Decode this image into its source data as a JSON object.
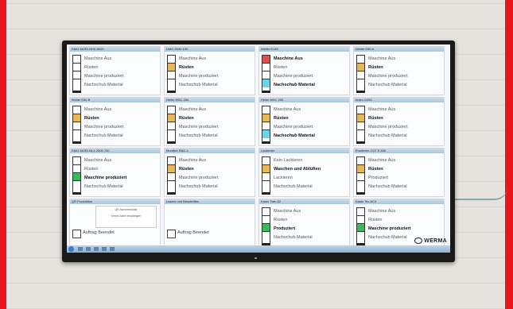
{
  "monitor": {
    "logo": "WERMA",
    "panels": [
      {
        "title": "DMG MORI NHX 8000",
        "labels": [
          "Maschine Aus",
          "Rüsten",
          "Maschine produziert",
          "Nachschub Material"
        ],
        "active": -1,
        "colors": [
          "#ffffff",
          "#ffffff",
          "#ffffff",
          "#ffffff"
        ]
      },
      {
        "title": "DMG DMU 100",
        "labels": [
          "Maschine Aus",
          "Rüsten",
          "Maschine produziert",
          "Nachschub Material"
        ],
        "active": 1,
        "colors": [
          "#ffffff",
          "#e8b857",
          "#ffffff",
          "#ffffff"
        ]
      },
      {
        "title": "Weiler E130",
        "labels": [
          "Maschine Aus",
          "Rüsten",
          "Maschine produziert",
          "Nachschub Material"
        ],
        "active": 0,
        "colors": [
          "#d9534f",
          "#ffffff",
          "#ffffff",
          "#6fd3e8"
        ],
        "bold": [
          0,
          3
        ]
      },
      {
        "title": "Weiler E50 A",
        "labels": [
          "Maschine Aus",
          "Rüsten",
          "Maschine produziert",
          "Nachschub Material"
        ],
        "active": 1,
        "colors": [
          "#ffffff",
          "#e8b857",
          "#ffffff",
          "#ffffff"
        ]
      },
      {
        "title": "Weiler E50 B",
        "labels": [
          "Maschine Aus",
          "Rüsten",
          "Maschine produziert",
          "Nachschub Material"
        ],
        "active": 1,
        "colors": [
          "#ffffff",
          "#e8b857",
          "#ffffff",
          "#ffffff"
        ]
      },
      {
        "title": "Heller MSC 250",
        "labels": [
          "Maschine Aus",
          "Rüsten",
          "Maschine produziert",
          "Nachschub Material"
        ],
        "active": 1,
        "colors": [
          "#ffffff",
          "#e8b857",
          "#ffffff",
          "#ffffff"
        ]
      },
      {
        "title": "Heller MSC 200",
        "labels": [
          "Maschine Aus",
          "Rüsten",
          "Maschine produziert",
          "Nachschub Material"
        ],
        "active": 1,
        "colors": [
          "#ffffff",
          "#e8b857",
          "#ffffff",
          "#6fd3e8"
        ],
        "bold": [
          1,
          3
        ]
      },
      {
        "title": "Index G250",
        "labels": [
          "Maschine Aus",
          "Rüsten",
          "Maschine produziert",
          "Nachschub Material"
        ],
        "active": 1,
        "colors": [
          "#ffffff",
          "#e8b857",
          "#ffffff",
          "#ffffff"
        ]
      },
      {
        "title": "DMG MORI NLX 2500 700",
        "labels": [
          "Maschine Aus",
          "Rüsten",
          "Maschine produziert",
          "Nachschub Material"
        ],
        "active": 2,
        "colors": [
          "#ffffff",
          "#ffffff",
          "#3cb95a",
          "#ffffff"
        ]
      },
      {
        "title": "Montfort RNC-1",
        "labels": [
          "Maschine Aus",
          "Rüsten",
          "Maschine produziert",
          "Nachschub Material"
        ],
        "active": 1,
        "colors": [
          "#ffffff",
          "#e8b857",
          "#ffffff",
          "#ffffff"
        ]
      },
      {
        "title": "Lackieren",
        "labels": [
          "Kein Lackieren",
          "Waschen und Ablüften",
          "Lackieren",
          "Nachschub Material"
        ],
        "active": 1,
        "colors": [
          "#ffffff",
          "#e8b857",
          "#ffffff",
          "#ffffff"
        ]
      },
      {
        "title": "Erodieren CUT E 600",
        "labels": [
          "Maschine Aus",
          "Rüsten",
          "Produziert",
          "Nachschub Material"
        ],
        "active": 1,
        "colors": [
          "#ffffff",
          "#e8b857",
          "#ffffff",
          "#ffffff"
        ]
      },
      {
        "title": "QR Produktion",
        "type": "qr",
        "qr_title": "QR-Nummernliste",
        "qr_text": "Keine Daten empfangen",
        "check_label": "Auftrag Beendet"
      },
      {
        "title": "Lasern und Beschriften",
        "type": "check",
        "check_label": "Auftrag Beendet"
      },
      {
        "title": "Kasto Twin A2",
        "labels": [
          "Maschine Aus",
          "Rüsten",
          "Produziert",
          "Nachschub Material"
        ],
        "active": 2,
        "colors": [
          "#ffffff",
          "#ffffff",
          "#3cb95a",
          "#ffffff"
        ]
      },
      {
        "title": "Kasto Tec AC4",
        "labels": [
          "Maschine Aus",
          "Rüsten",
          "Maschine produziert",
          "Nachschub Material"
        ],
        "active": 2,
        "colors": [
          "#ffffff",
          "#ffffff",
          "#3cb95a",
          "#ffffff"
        ]
      }
    ]
  }
}
